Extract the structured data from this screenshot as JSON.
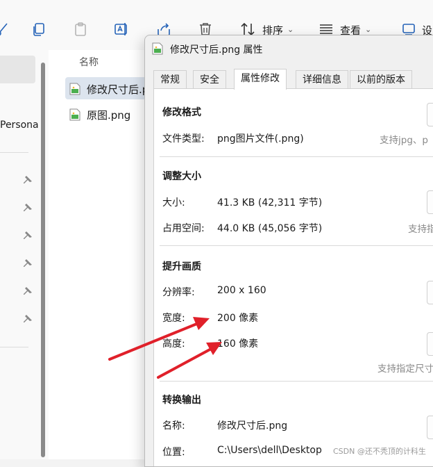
{
  "toolbar": {
    "sort_label": "排序",
    "view_label": "查看",
    "settings_label": "设"
  },
  "nav": {
    "partial_item": "Persona"
  },
  "file_list": {
    "column_name": "名称",
    "files": [
      {
        "name": "修改尺寸后.p",
        "selected": true
      },
      {
        "name": "原图.png",
        "selected": false
      }
    ]
  },
  "dialog": {
    "title": "修改尺寸后.png 属性",
    "tabs": [
      "常规",
      "安全",
      "属性修改",
      "详细信息",
      "以前的版本"
    ],
    "active_tab": "属性修改",
    "sections": {
      "format": {
        "title": "修改格式",
        "file_type_label": "文件类型:",
        "file_type_value": "png图片文件(.png)",
        "hint": "支持jpg、p"
      },
      "resize": {
        "title": "调整大小",
        "size_label": "大小:",
        "size_value": "41.3 KB (42,311 字节)",
        "disk_label": "占用空间:",
        "disk_value": "44.0 KB (45,056 字节)",
        "hint": "支持指"
      },
      "quality": {
        "title": "提升画质",
        "resolution_label": "分辨率:",
        "resolution_value": "200 x 160",
        "width_label": "宽度:",
        "width_value": "200 像素",
        "height_label": "高度:",
        "height_value": "160 像素",
        "hint": "支持指定尺寸"
      },
      "output": {
        "title": "转换输出",
        "name_label": "名称:",
        "name_value": "修改尺寸后.png",
        "location_label": "位置:",
        "location_value": "C:\\Users\\dell\\Desktop"
      }
    }
  },
  "annotation": {
    "arrow_color": "#e0202a"
  },
  "watermark": "CSDN @还不秃顶的计科生"
}
